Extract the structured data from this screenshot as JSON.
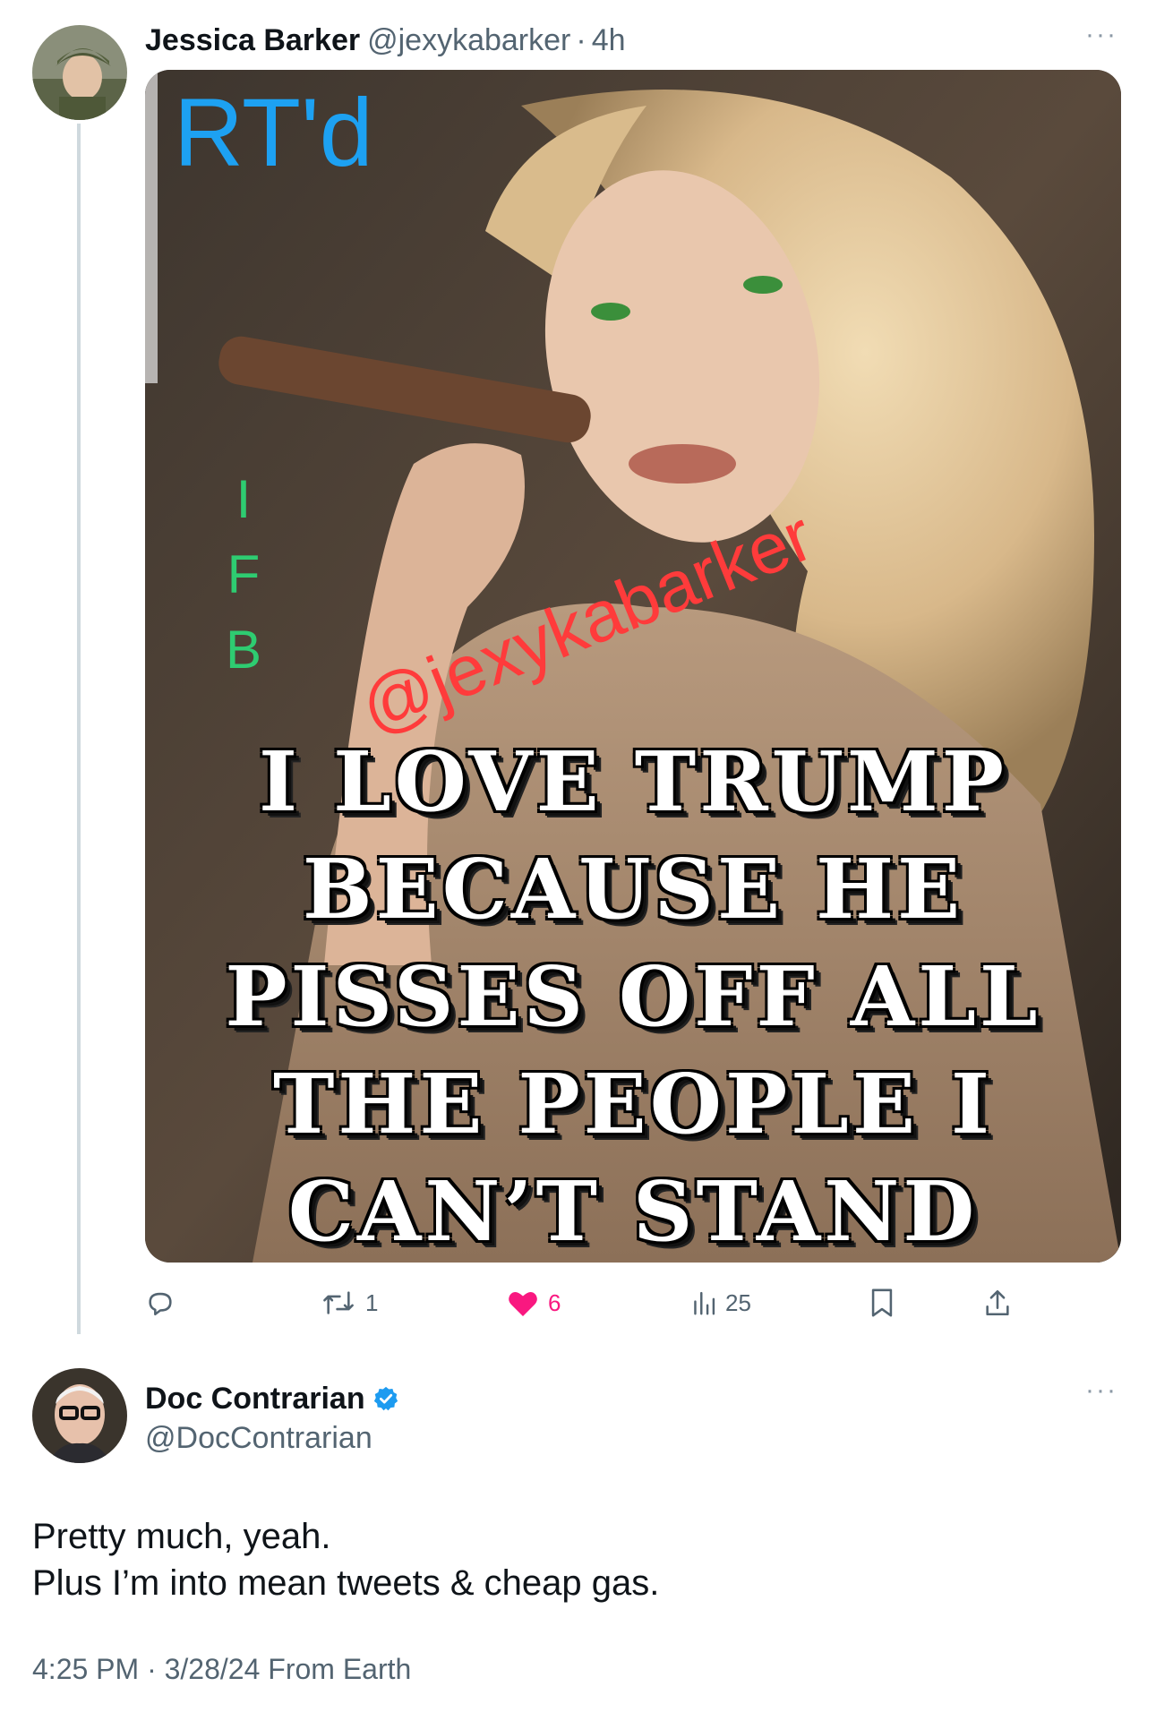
{
  "retweeted_post": {
    "author_name": "Jessica Barker",
    "author_handle": "@jexykabarker",
    "separator": "·",
    "age": "4h",
    "more_label": "···",
    "image": {
      "overlay_top": "RT'd",
      "overlay_side": [
        "I",
        "F",
        "B"
      ],
      "watermark": "@jexykabarker",
      "caption_lines": [
        "I LOVE TRUMP",
        "BECAUSE HE",
        "PISSES OFF ALL",
        "THE PEOPLE I",
        "CAN’T STAND"
      ]
    },
    "actions": {
      "reply_icon": "reply-icon",
      "retweets": "1",
      "likes": "6",
      "views": "25",
      "bookmark_icon": "bookmark-icon",
      "share_icon": "share-icon"
    },
    "colors": {
      "like": "#f91880",
      "overlay_rtd": "#1da1f2",
      "overlay_ifb": "#2ecc71",
      "watermark": "#ff3b3b"
    }
  },
  "reply_post": {
    "author_name": "Doc Contrarian",
    "author_handle": "@DocContrarian",
    "verified": true,
    "more_label": "···",
    "text_lines": [
      "Pretty much, yeah.",
      "Plus I’m into mean tweets & cheap gas."
    ],
    "timestamp": "4:25 PM · 3/28/24 From Earth"
  }
}
